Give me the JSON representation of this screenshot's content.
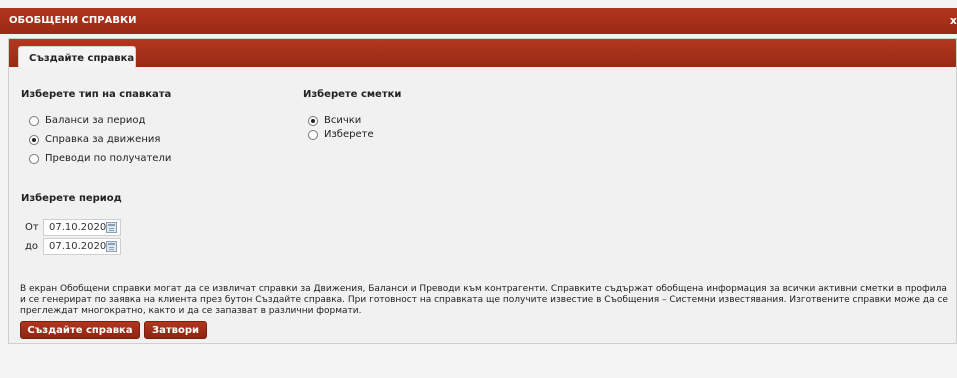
{
  "window": {
    "title": "ОБОБЩЕНИ СПРАВКИ",
    "close": "x"
  },
  "tabs": [
    {
      "label": "Създайте справка"
    }
  ],
  "report_type": {
    "heading": "Изберете тип на спавката",
    "options": [
      {
        "label": "Баланси за период",
        "checked": false
      },
      {
        "label": "Справка за движения",
        "checked": true
      },
      {
        "label": "Преводи по получатели",
        "checked": false
      }
    ]
  },
  "accounts": {
    "heading": "Изберете сметки",
    "options": [
      {
        "label": "Всички",
        "checked": true
      },
      {
        "label": "Изберете",
        "checked": false
      }
    ]
  },
  "period": {
    "heading": "Изберете период",
    "from": {
      "label": "От",
      "value": "07.10.2020"
    },
    "to": {
      "label": "до",
      "value": "07.10.2020"
    }
  },
  "description": "В екран Обобщени справки могат да се извличат справки за Движения, Баланси и Преводи към контрагенти. Справките съдържат обобщена информация за всички активни сметки в профила и се генерират по заявка на клиента през бутон Създайте справка. При готовност на справката ще получите известие в Съобщения – Системни известявания. Изготвените справки може да се преглеждат многократно, както и да се запазват в различни формати.",
  "buttons": {
    "create": "Създайте справка",
    "close": "Затвори"
  },
  "colors": {
    "accent": "#a3301a",
    "background": "#f3f3f3"
  }
}
